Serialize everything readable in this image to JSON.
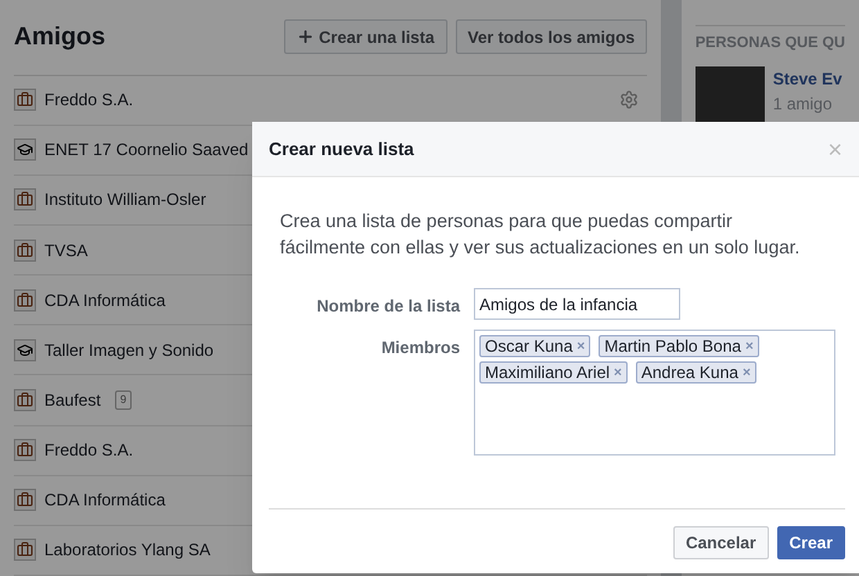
{
  "page": {
    "title": "Amigos",
    "buttons": [
      {
        "kind": "create",
        "label": "Crear una lista"
      },
      {
        "kind": "plain",
        "label": "Ver todos los amigos"
      }
    ]
  },
  "lists": [
    {
      "name": "Freddo S.A.",
      "kind": "work",
      "settings": true
    },
    {
      "name": "ENET 17 Coornelio Saaved",
      "kind": "school"
    },
    {
      "name": "Instituto William-Osler",
      "kind": "work"
    },
    {
      "name": "TVSA",
      "kind": "work"
    },
    {
      "name": "CDA Informática",
      "kind": "work"
    },
    {
      "name": "Taller Imagen y Sonido",
      "kind": "school"
    },
    {
      "name": "Baufest",
      "kind": "work",
      "count": "9"
    },
    {
      "name": "Freddo S.A.",
      "kind": "work"
    },
    {
      "name": "CDA Informática",
      "kind": "work"
    },
    {
      "name": "Laboratorios Ylang SA",
      "kind": "work"
    }
  ],
  "suggestions": {
    "heading": "PERSONAS QUE QU",
    "people": [
      {
        "name": "Steve Ev",
        "detail": "1 amigo"
      }
    ]
  },
  "dialog": {
    "title": "Crear nueva lista",
    "description": "Crea una lista de personas para que puedas compartir fácilmente con ellas y ver sus actualizaciones en un solo lugar.",
    "name_label": "Nombre de la lista",
    "name_value": "Amigos de la infancia",
    "members_label": "Miembros",
    "members": [
      {
        "name": "Oscar Kuna",
        "remove": "×"
      },
      {
        "name": "Martin Pablo Bona",
        "remove": "×"
      },
      {
        "name": "Maximiliano Ariel",
        "remove": "×"
      },
      {
        "name": "Andrea Kuna",
        "remove": "×"
      }
    ],
    "close": "×",
    "buttons": [
      {
        "kind": "secondary",
        "label": "Cancelar"
      },
      {
        "kind": "primary",
        "label": "Crear"
      }
    ]
  }
}
